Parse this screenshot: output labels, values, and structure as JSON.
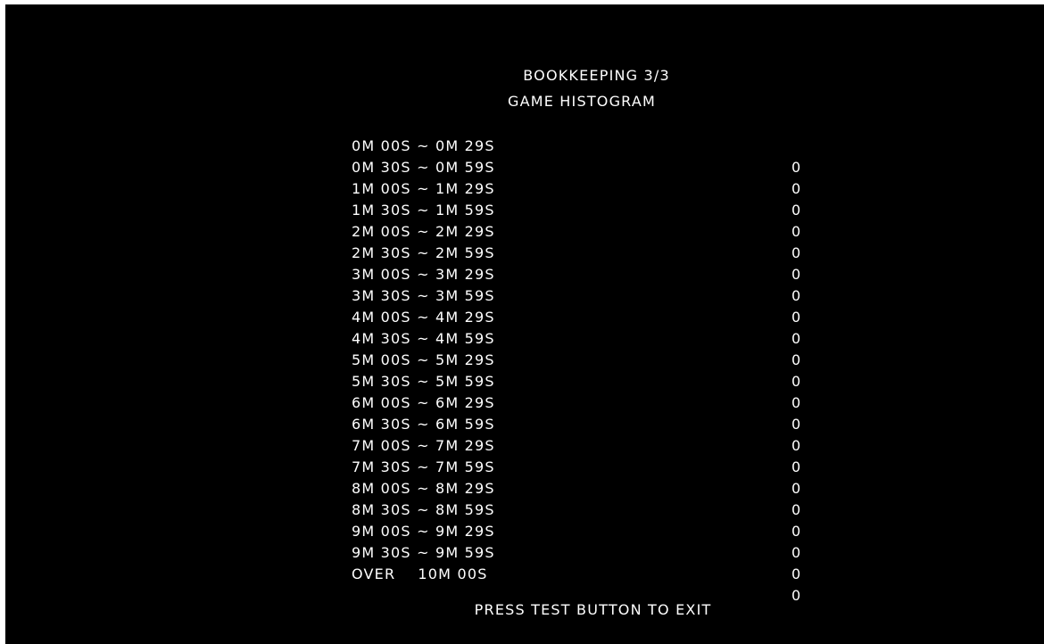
{
  "screen": {
    "title": "BOOKKEEPING 3/3",
    "subtitle": "GAME HISTOGRAM",
    "footer": "PRESS TEST BUTTON TO EXIT",
    "colors": {
      "background": "#000000",
      "text": "#ffffff"
    }
  },
  "histogram": {
    "rows": [
      {
        "range": "0M 00S ~ 0M 29S",
        "count": "0"
      },
      {
        "range": "0M 30S ~ 0M 59S",
        "count": "0"
      },
      {
        "range": "1M 00S ~ 1M 29S",
        "count": "0"
      },
      {
        "range": "1M 30S ~ 1M 59S",
        "count": "0"
      },
      {
        "range": "2M 00S ~ 2M 29S",
        "count": "0"
      },
      {
        "range": "2M 30S ~ 2M 59S",
        "count": "0"
      },
      {
        "range": "3M 00S ~ 3M 29S",
        "count": "0"
      },
      {
        "range": "3M 30S ~ 3M 59S",
        "count": "0"
      },
      {
        "range": "4M 00S ~ 4M 29S",
        "count": "0"
      },
      {
        "range": "4M 30S ~ 4M 59S",
        "count": "0"
      },
      {
        "range": "5M 00S ~ 5M 29S",
        "count": "0"
      },
      {
        "range": "5M 30S ~ 5M 59S",
        "count": "0"
      },
      {
        "range": "6M 00S ~ 6M 29S",
        "count": "0"
      },
      {
        "range": "6M 30S ~ 6M 59S",
        "count": "0"
      },
      {
        "range": "7M 00S ~ 7M 29S",
        "count": "0"
      },
      {
        "range": "7M 30S ~ 7M 59S",
        "count": "0"
      },
      {
        "range": "8M 00S ~ 8M 29S",
        "count": "0"
      },
      {
        "range": "8M 30S ~ 8M 59S",
        "count": "0"
      },
      {
        "range": "9M 00S ~ 9M 29S",
        "count": "0"
      },
      {
        "range": "9M 30S ~ 9M 59S",
        "count": "0"
      },
      {
        "range": "OVER    10M 00S",
        "count": "0"
      }
    ]
  }
}
